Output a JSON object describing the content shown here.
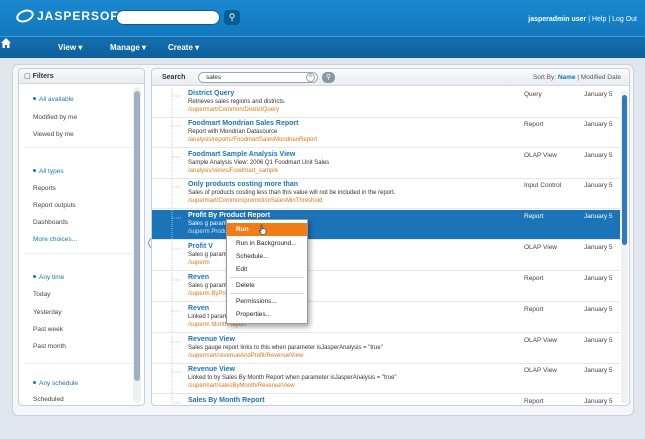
{
  "app": {
    "logo": "JASPERSOFT",
    "user": "jasperadmin user",
    "links": [
      "Help",
      "Log Out"
    ]
  },
  "nav": {
    "items": [
      "View",
      "Manage",
      "Create"
    ]
  },
  "filters": {
    "title": "Filters",
    "groups": [
      {
        "items": [
          "All available",
          "Modified by me",
          "Viewed by me"
        ],
        "selected": 0
      },
      {
        "items": [
          "All types",
          "Reports",
          "Report outputs",
          "Dashboards",
          "More choices..."
        ],
        "selected": 0
      },
      {
        "items": [
          "Any time",
          "Today",
          "Yesterday",
          "Past week",
          "Past month"
        ],
        "selected": 0
      },
      {
        "items": [
          "Any schedule",
          "Scheduled"
        ],
        "selected": 0
      }
    ]
  },
  "search": {
    "label": "Search",
    "value": "sales",
    "clear": "×"
  },
  "sort": {
    "label": "Sort By:",
    "name": "Name",
    "date": "Modified Date"
  },
  "results": [
    {
      "title": "District Query",
      "desc": "Retrieves sales regions and districts.",
      "path": "/supermart/Common/DistrictQuery",
      "type": "Query",
      "date": "January 5"
    },
    {
      "title": "Foodmart Mondrian Sales Report",
      "desc": "Report with Mondrian Datasource",
      "path": "/analysis/reports/FoodmartSalesMondrianReport",
      "type": "Report",
      "date": "January 5"
    },
    {
      "title": "Foodmart Sample Analysis View",
      "desc": "Sample Analysis View: 2006 Q1 Foodmart Unit Sales",
      "path": "/analysis/views/Foodmart_sample",
      "type": "OLAP View",
      "date": "January 5"
    },
    {
      "title": "Only products costing more than",
      "desc": "Sales of products costing less than this value will not be included in the report.",
      "path": "/supermart/Common/promotionSalesMinThreshold",
      "type": "Input Control",
      "date": "January 5"
    },
    {
      "title": "Profit By Product Report",
      "desc": "Sales g                    parameter isJasperAnalysis = \"false\"",
      "path": "/superm                         ProductReport",
      "type": "Report",
      "date": "January 5"
    },
    {
      "title": "Profit V",
      "desc": "Sales g                    parameter isJasperAnalysis = \"true\"",
      "path": "/superm",
      "type": "OLAP View",
      "date": "January 5"
    },
    {
      "title": "Reven",
      "desc": "Sales g                    parameter isJasperAnalysis = \"false\"",
      "path": "/superm                         ByProductTypeReport",
      "type": "Report",
      "date": "January 5"
    },
    {
      "title": "Reven",
      "desc": "Linked t                    parameter isJasperAnalysis = \"false\"",
      "path": "/superm                         MonthReport",
      "type": "Report",
      "date": "January 5"
    },
    {
      "title": "Revenue View",
      "desc": "Sales gauge report links to this when parameter isJasperAnalysis = \"true\"",
      "path": "/supermart/revenueAndProfit/RevenueView",
      "type": "OLAP View",
      "date": "January 5"
    },
    {
      "title": "Revenue View",
      "desc": "Linked to by Sales By Month Report when parameter isJasperAnalysis = \"true\"",
      "path": "/supermart/salesByMonth/RevenueView",
      "type": "OLAP View",
      "date": "January 5"
    },
    {
      "title": "Sales By Month Report",
      "desc": "",
      "path": "",
      "type": "Report",
      "date": "January 5"
    }
  ],
  "context_menu": {
    "items": [
      "Run",
      "Run in Background...",
      "Schedule...",
      "Edit",
      "Delete",
      "Permissions...",
      "Properties..."
    ],
    "highlighted": "Run"
  }
}
